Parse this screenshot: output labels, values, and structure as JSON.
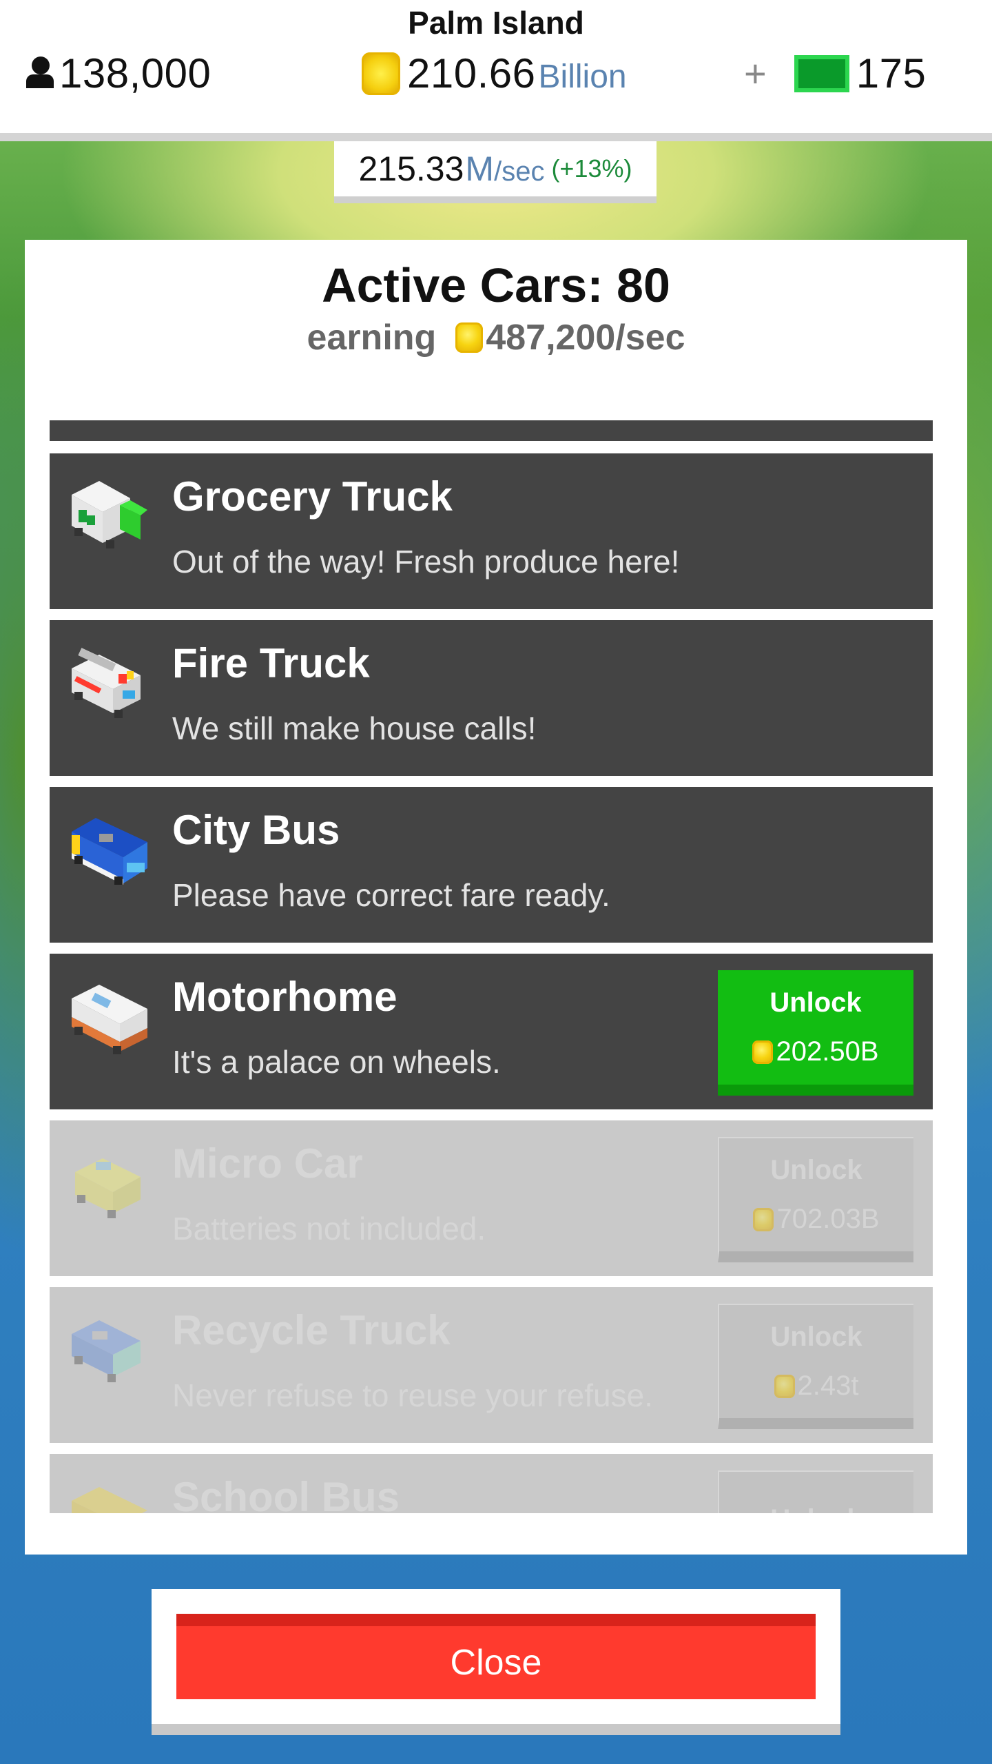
{
  "hud": {
    "island_name": "Palm Island",
    "population": "138,000",
    "coins_value": "210.66",
    "coins_unit": "Billion",
    "plus_label": "+",
    "cash_value": "175",
    "rate_value": "215.33",
    "rate_unit_m": "M",
    "rate_unit_sec": "/sec",
    "rate_pct": "(+13%)"
  },
  "panel": {
    "title": "Active Cars: 80",
    "earning_label": "earning",
    "earning_amount": "487,200/sec"
  },
  "cars": [
    {
      "title": "Grocery Truck",
      "desc": "Out of the way! Fresh produce here!",
      "icon": "grocery-truck-icon",
      "state": "owned"
    },
    {
      "title": "Fire Truck",
      "desc": "We still make house calls!",
      "icon": "fire-truck-icon",
      "state": "owned"
    },
    {
      "title": "City Bus",
      "desc": "Please have correct fare ready.",
      "icon": "city-bus-icon",
      "state": "owned"
    },
    {
      "title": "Motorhome",
      "desc": "It's a palace on wheels.",
      "icon": "motorhome-icon",
      "state": "unlockable",
      "unlock_label": "Unlock",
      "price": "202.50B"
    },
    {
      "title": "Micro Car",
      "desc": "Batteries not included.",
      "icon": "micro-car-icon",
      "state": "locked",
      "unlock_label": "Unlock",
      "price": "702.03B"
    },
    {
      "title": "Recycle Truck",
      "desc": "Never refuse to reuse your refuse.",
      "icon": "recycle-truck-icon",
      "state": "locked",
      "unlock_label": "Unlock",
      "price": "2.43t"
    },
    {
      "title": "School Bus",
      "desc": "",
      "icon": "school-bus-icon",
      "state": "locked",
      "unlock_label": "Unlock",
      "price": ""
    }
  ],
  "close_label": "Close",
  "colors": {
    "unlock_green": "#12bd12",
    "close_red": "#ff3a2e",
    "row_dark": "#444444",
    "row_locked": "#c9c9c9",
    "rate_pct_green": "#1c8a3a",
    "unit_blue": "#5a83b0"
  }
}
